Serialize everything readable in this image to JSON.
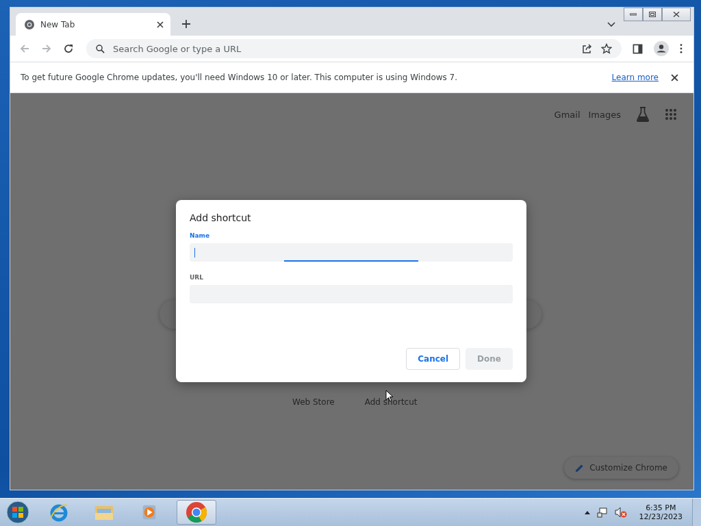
{
  "tabs": [
    {
      "title": "New Tab",
      "selected": true
    }
  ],
  "omnibox": {
    "placeholder": "Search Google or type a URL"
  },
  "infobar": {
    "message": "To get future Google Chrome updates, you'll need Windows 10 or later. This computer is using Windows 7.",
    "link": "Learn more"
  },
  "ntp": {
    "header_links": [
      "Gmail",
      "Images"
    ],
    "shortcuts": [
      {
        "label": "Web Store"
      },
      {
        "label": "Add shortcut"
      }
    ],
    "customize_button": "Customize Chrome"
  },
  "dialog": {
    "title": "Add shortcut",
    "fields": [
      {
        "label": "Name",
        "focused": true
      },
      {
        "label": "URL",
        "focused": false
      }
    ],
    "buttons": [
      {
        "label": "Cancel",
        "disabled": false
      },
      {
        "label": "Done",
        "disabled": true
      }
    ]
  },
  "taskbar": {
    "apps": [
      {
        "kind": "ie",
        "selected": false
      },
      {
        "kind": "explorer",
        "selected": false
      },
      {
        "kind": "media",
        "selected": false
      },
      {
        "kind": "chrome",
        "selected": true
      }
    ],
    "time": "6:35 PM",
    "date": "12/23/2023"
  }
}
